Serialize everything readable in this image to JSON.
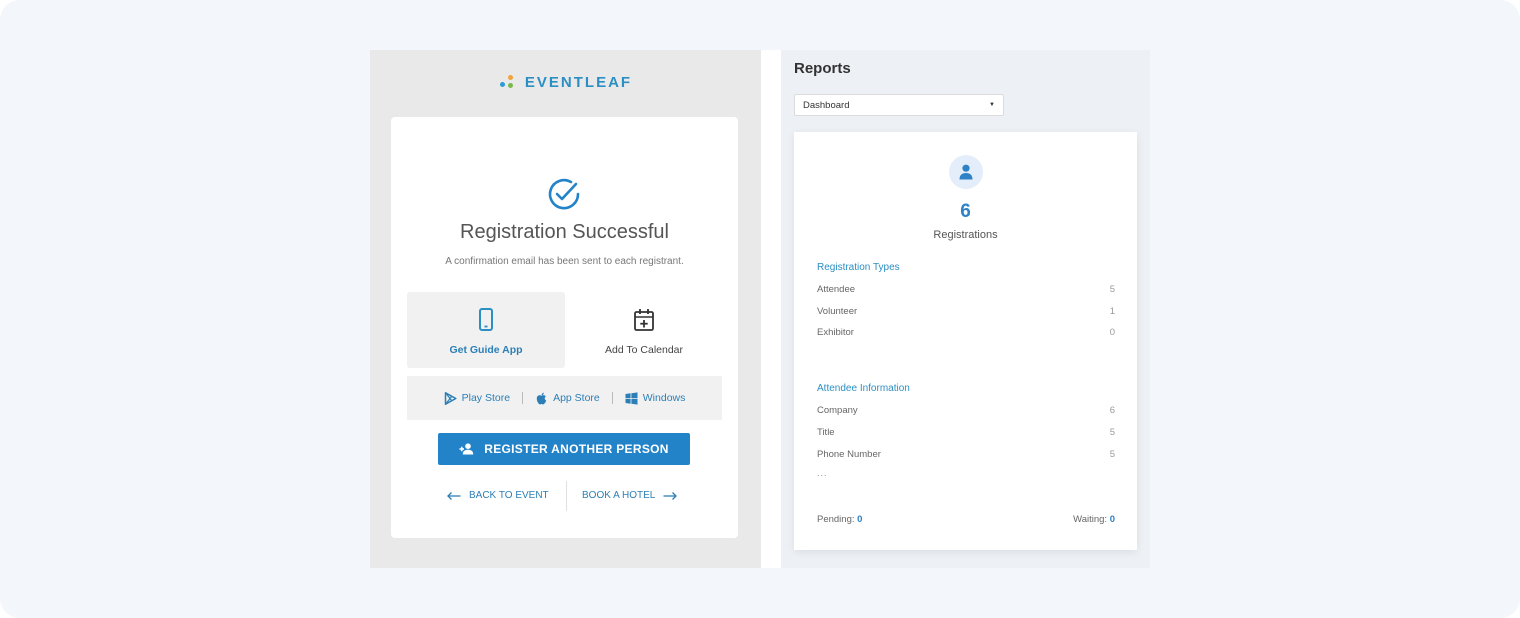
{
  "brand": {
    "name": "EVENTLEAF"
  },
  "registration": {
    "title": "Registration Successful",
    "subtitle": "A confirmation email has been sent to each registrant.",
    "tiles": {
      "guide_app": "Get Guide App",
      "add_calendar": "Add To Calendar"
    },
    "stores": {
      "play": "Play Store",
      "app": "App Store",
      "windows": "Windows"
    },
    "register_button": "REGISTER ANOTHER PERSON",
    "back_link": "BACK TO EVENT",
    "hotel_link": "BOOK A HOTEL"
  },
  "reports": {
    "title": "Reports",
    "select_value": "Dashboard",
    "total_count": "6",
    "total_label": "Registrations",
    "registration_types": {
      "title": "Registration Types",
      "rows": [
        {
          "label": "Attendee",
          "value": "5"
        },
        {
          "label": "Volunteer",
          "value": "1"
        },
        {
          "label": "Exhibitor",
          "value": "0"
        }
      ]
    },
    "attendee_info": {
      "title": "Attendee Information",
      "rows": [
        {
          "label": "Company",
          "value": "6"
        },
        {
          "label": "Title",
          "value": "5"
        },
        {
          "label": "Phone Number",
          "value": "5"
        }
      ],
      "more": "..."
    },
    "pending_label": "Pending:",
    "pending_value": "0",
    "waiting_label": "Waiting:",
    "waiting_value": "0"
  },
  "colors": {
    "accent": "#2383c9",
    "link": "#2c7fb6",
    "brand_dot_orange": "#f2a33a",
    "brand_dot_blue": "#2f9bd6",
    "brand_dot_green": "#79b94b"
  },
  "icons": {
    "success": "check-circle-icon",
    "phone": "smartphone-icon",
    "calendar": "calendar-plus-icon",
    "play": "play-store-icon",
    "apple": "apple-icon",
    "windows": "windows-icon",
    "add_user": "add-user-icon",
    "user": "user-icon"
  }
}
